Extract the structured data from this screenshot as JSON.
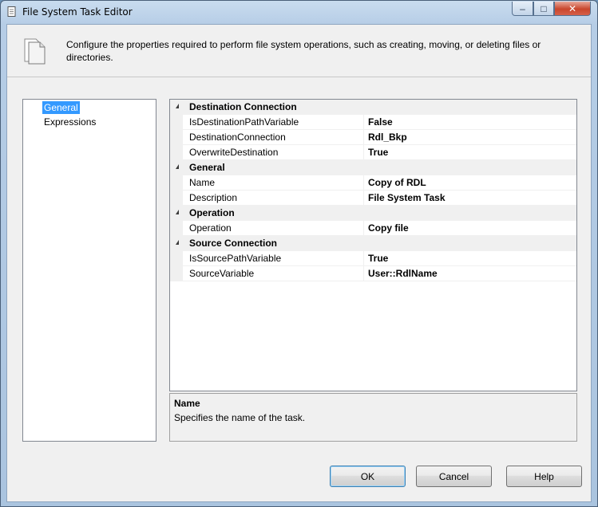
{
  "window": {
    "title": "File System Task Editor",
    "minimize_glyph": "–",
    "maximize_glyph": "□",
    "close_glyph": "✕"
  },
  "header": {
    "description": "Configure the properties required to perform file system operations, such as creating, moving, or deleting files or directories."
  },
  "nav": {
    "items": [
      {
        "label": "General",
        "selected": true
      },
      {
        "label": "Expressions",
        "selected": false
      }
    ]
  },
  "properties": {
    "categories": [
      {
        "name": "Destination Connection",
        "rows": [
          {
            "name": "IsDestinationPathVariable",
            "value": "False"
          },
          {
            "name": "DestinationConnection",
            "value": "Rdl_Bkp"
          },
          {
            "name": "OverwriteDestination",
            "value": "True"
          }
        ]
      },
      {
        "name": "General",
        "rows": [
          {
            "name": "Name",
            "value": "Copy of RDL"
          },
          {
            "name": "Description",
            "value": "File System Task"
          }
        ]
      },
      {
        "name": "Operation",
        "rows": [
          {
            "name": "Operation",
            "value": "Copy file"
          }
        ]
      },
      {
        "name": "Source Connection",
        "rows": [
          {
            "name": "IsSourcePathVariable",
            "value": "True"
          },
          {
            "name": "SourceVariable",
            "value": "User::RdlName"
          }
        ]
      }
    ]
  },
  "description_panel": {
    "title": "Name",
    "text": "Specifies the name of the task."
  },
  "buttons": {
    "ok": "OK",
    "cancel": "Cancel",
    "help": "Help"
  },
  "colors": {
    "selection": "#3399ff",
    "category_background": "#f0f0f0",
    "close_button": "#c9462c"
  }
}
